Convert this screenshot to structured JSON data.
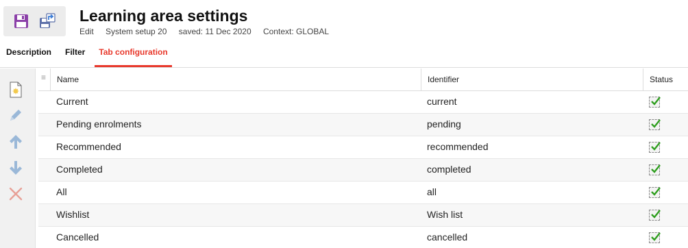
{
  "header": {
    "title": "Learning area settings",
    "meta": {
      "mode": "Edit",
      "setup": "System setup 20",
      "saved": "saved: 11 Dec 2020",
      "context": "Context: GLOBAL"
    },
    "toolbar": {
      "save_icon": "floppy-disk-icon",
      "save_as_icon": "floppy-disk-arrow-icon"
    }
  },
  "tabs": [
    {
      "label": "Description",
      "active": false
    },
    {
      "label": "Filter",
      "active": false
    },
    {
      "label": "Tab configuration",
      "active": true
    }
  ],
  "side_actions": [
    {
      "name": "new-tab-button",
      "icon": "new-document-icon"
    },
    {
      "name": "edit-button",
      "icon": "pencil-icon"
    },
    {
      "name": "move-up-button",
      "icon": "arrow-up-icon"
    },
    {
      "name": "move-down-button",
      "icon": "arrow-down-icon"
    },
    {
      "name": "delete-button",
      "icon": "cross-icon"
    }
  ],
  "table": {
    "columns": [
      "Name",
      "Identifier",
      "Status"
    ],
    "rows": [
      {
        "name": "Current",
        "identifier": "current",
        "status": true
      },
      {
        "name": "Pending enrolments",
        "identifier": "pending",
        "status": true
      },
      {
        "name": "Recommended",
        "identifier": "recommended",
        "status": true
      },
      {
        "name": "Completed",
        "identifier": "completed",
        "status": true
      },
      {
        "name": "All",
        "identifier": "all",
        "status": true
      },
      {
        "name": "Wishlist",
        "identifier": "Wish list",
        "status": true
      },
      {
        "name": "Cancelled",
        "identifier": "cancelled",
        "status": true
      }
    ]
  },
  "colors": {
    "accent": "#e8382b",
    "icon_purple": "#8b3fa8",
    "icon_blue": "#9ab8d8",
    "icon_red": "#e8a097",
    "check_green": "#2e9e1e"
  }
}
